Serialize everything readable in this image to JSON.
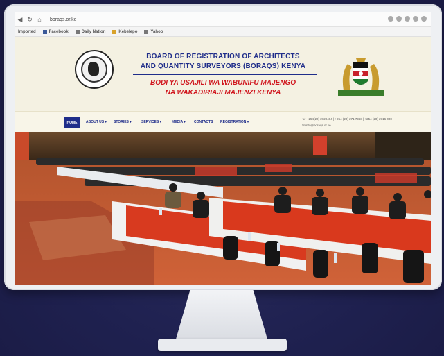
{
  "browser": {
    "url": "boraqs.or.ke",
    "bookmarks": [
      "Imported",
      "Facebook",
      "Daily Nation",
      "Kebelepo",
      "Yahoo"
    ]
  },
  "site": {
    "title_line1": "BOARD OF REGISTRATION OF ARCHITECTS",
    "title_line2": "AND QUANTITY SURVEYORS (BORAQS) KENYA",
    "swahili_line1": "BODI YA USAJILI WA WABUNIFU MAJENGO",
    "swahili_line2": "NA WAKADIRIAJI MAJENZI KENYA",
    "nav": {
      "home": "HOME",
      "items": [
        "ABOUT US ▾",
        "STORIES ▾",
        "SERVICES ▾",
        "MEDIA ▾",
        "CONTACTS",
        "REGISTRATION ▾"
      ]
    },
    "contact_line1": "☏ +254(20) 2729464 | +254 (20) 271 7968 | +254 (20) 2716 000",
    "contact_line2": "✉ info@boraqs.or.ke"
  },
  "colors": {
    "brand_blue": "#1f2d8a",
    "brand_red": "#d0151d",
    "header_bg": "#f4f1e2",
    "background": "#1f2150"
  },
  "icons": [
    "back-icon",
    "reload-icon",
    "bookmark-folder-icon",
    "board-seal-logo",
    "kenya-coat-of-arms"
  ]
}
